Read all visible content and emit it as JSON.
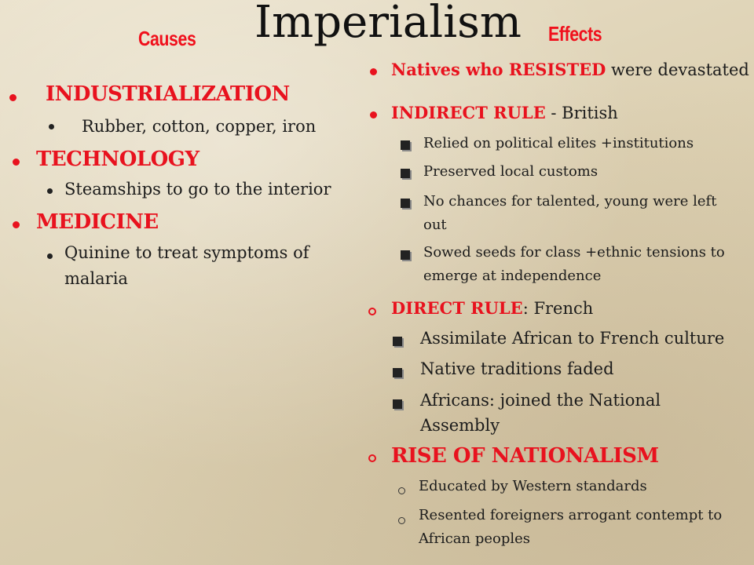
{
  "title": "Imperialism",
  "causes_label": "Causes",
  "effects_label": "Effects",
  "causes": {
    "industrialization": "INDUSTRIALIZATION",
    "industrialization_sub": "Rubber, cotton, copper, iron",
    "technology": "TECHNOLOGY",
    "technology_sub": "Steamships to go to the interior",
    "medicine": "MEDICINE",
    "medicine_sub_1": "Quinine to treat symptoms of",
    "medicine_sub_2": "malaria"
  },
  "effects": {
    "resisted_red": "Natives who RESISTED",
    "resisted_rest": " were devastated",
    "indirect_red": "INDIRECT RULE",
    "indirect_rest": " - British",
    "indirect_items": [
      "Relied on political elites +institutions",
      "Preserved local customs",
      "No chances for talented, young were left",
      "out",
      "Sowed seeds for class +ethnic tensions to",
      "emerge at independence"
    ],
    "direct_red": "DIRECT RULE",
    "direct_rest": ": French",
    "direct_items": [
      "Assimilate African to French culture",
      "Native traditions faded",
      "Africans: joined the National",
      "Assembly"
    ],
    "nationalism": "RISE OF NATIONALISM",
    "nationalism_items": [
      "Educated by Western standards",
      "Resented foreigners arrogant contempt to",
      "African peoples"
    ]
  }
}
